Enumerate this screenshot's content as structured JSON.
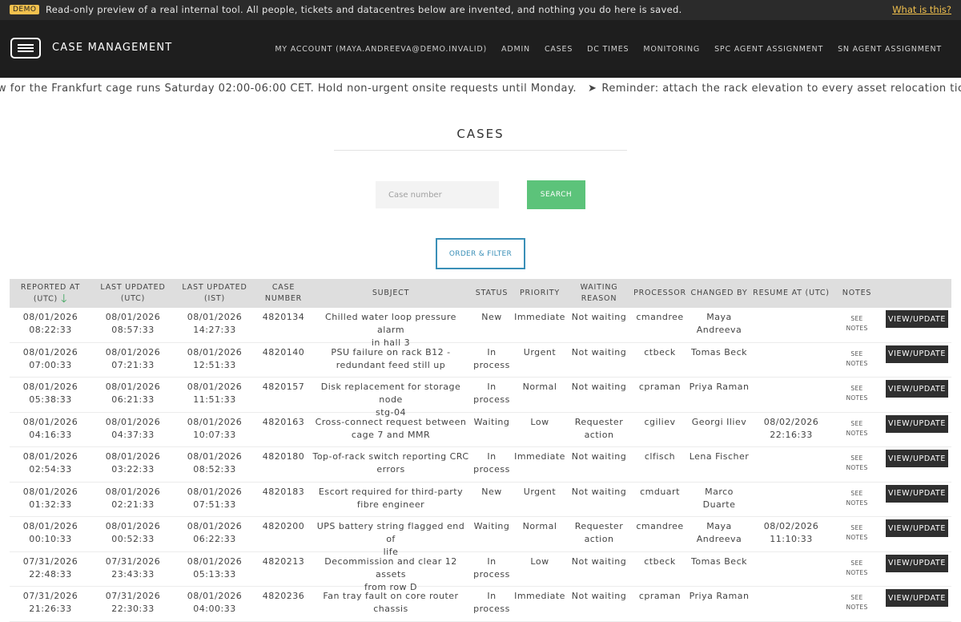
{
  "demo_bar": {
    "badge": "DEMO",
    "text": "Read-only preview of a real internal tool. All people, tickets and datacentres below are invented, and nothing you do here is saved.",
    "link": "What is this?"
  },
  "header": {
    "title": "CASE MANAGEMENT",
    "logo_icon": "menu-card-icon",
    "menu": [
      "MY ACCOUNT (MAYA.ANDREEVA@DEMO.INVALID)",
      "ADMIN",
      "CASES",
      "DC TIMES",
      "MONITORING",
      "SPC AGENT ASSIGNMENT",
      "SN AGENT ASSIGNMENT"
    ]
  },
  "ticker": {
    "text1": "w for the Frankfurt cage runs Saturday 02:00-06:00 CET. Hold non-urgent onsite requests until Monday.",
    "separator": "➤",
    "text2": "Reminder: attach the rack elevation to every asset relocation ticket b"
  },
  "page": {
    "title": "CASES",
    "search_placeholder": "Case number",
    "search_button": "SEARCH",
    "filter_button": "ORDER & FILTER"
  },
  "table": {
    "columns": {
      "reported_at": [
        "REPORTED AT",
        "(UTC)"
      ],
      "last_updated_utc": [
        "LAST UPDATED",
        "(UTC)"
      ],
      "last_updated_ist": [
        "LAST UPDATED",
        "(IST)"
      ],
      "case_number": [
        "CASE",
        "NUMBER"
      ],
      "subject": [
        "SUBJECT"
      ],
      "status": [
        "STATUS"
      ],
      "priority": [
        "PRIORITY"
      ],
      "waiting_reason": [
        "WAITING",
        "REASON"
      ],
      "processor": [
        "PROCESSOR"
      ],
      "changed_by": [
        "CHANGED BY"
      ],
      "resume_at": [
        "RESUME AT (UTC)"
      ],
      "notes": [
        "NOTES"
      ]
    },
    "sort_icon": "arrow-down-icon",
    "see_notes": "SEE\nNOTES",
    "view_update": "VIEW/UPDATE",
    "rows": [
      {
        "reported": "08/01/2026\n08:22:33",
        "upd_utc": "08/01/2026\n08:57:33",
        "upd_ist": "08/01/2026\n14:27:33",
        "case": "4820134",
        "subject": "Chilled water loop pressure alarm\nin hall 3",
        "status": "New",
        "priority": "Immediate",
        "waiting": "Not waiting",
        "processor": "cmandree",
        "changed_by": "Maya\nAndreeva",
        "resume": ""
      },
      {
        "reported": "08/01/2026\n07:00:33",
        "upd_utc": "08/01/2026\n07:21:33",
        "upd_ist": "08/01/2026\n12:51:33",
        "case": "4820140",
        "subject": "PSU failure on rack B12 -\nredundant feed still up",
        "status": "In\nprocess",
        "priority": "Urgent",
        "waiting": "Not waiting",
        "processor": "ctbeck",
        "changed_by": "Tomas Beck",
        "resume": ""
      },
      {
        "reported": "08/01/2026\n05:38:33",
        "upd_utc": "08/01/2026\n06:21:33",
        "upd_ist": "08/01/2026\n11:51:33",
        "case": "4820157",
        "subject": "Disk replacement for storage node\nstg-04",
        "status": "In\nprocess",
        "priority": "Normal",
        "waiting": "Not waiting",
        "processor": "cpraman",
        "changed_by": "Priya Raman",
        "resume": ""
      },
      {
        "reported": "08/01/2026\n04:16:33",
        "upd_utc": "08/01/2026\n04:37:33",
        "upd_ist": "08/01/2026\n10:07:33",
        "case": "4820163",
        "subject": "Cross-connect request between\ncage 7 and MMR",
        "status": "Waiting",
        "priority": "Low",
        "waiting": "Requester\naction",
        "processor": "cgiliev",
        "changed_by": "Georgi Iliev",
        "resume": "08/02/2026\n22:16:33"
      },
      {
        "reported": "08/01/2026\n02:54:33",
        "upd_utc": "08/01/2026\n03:22:33",
        "upd_ist": "08/01/2026\n08:52:33",
        "case": "4820180",
        "subject": "Top-of-rack switch reporting CRC\nerrors",
        "status": "In\nprocess",
        "priority": "Immediate",
        "waiting": "Not waiting",
        "processor": "clfisch",
        "changed_by": "Lena Fischer",
        "resume": ""
      },
      {
        "reported": "08/01/2026\n01:32:33",
        "upd_utc": "08/01/2026\n02:21:33",
        "upd_ist": "08/01/2026\n07:51:33",
        "case": "4820183",
        "subject": "Escort required for third-party\nfibre engineer",
        "status": "New",
        "priority": "Urgent",
        "waiting": "Not waiting",
        "processor": "cmduart",
        "changed_by": "Marco\nDuarte",
        "resume": ""
      },
      {
        "reported": "08/01/2026\n00:10:33",
        "upd_utc": "08/01/2026\n00:52:33",
        "upd_ist": "08/01/2026\n06:22:33",
        "case": "4820200",
        "subject": "UPS battery string flagged end of\nlife",
        "status": "Waiting",
        "priority": "Normal",
        "waiting": "Requester\naction",
        "processor": "cmandree",
        "changed_by": "Maya\nAndreeva",
        "resume": "08/02/2026\n11:10:33"
      },
      {
        "reported": "07/31/2026\n22:48:33",
        "upd_utc": "07/31/2026\n23:43:33",
        "upd_ist": "08/01/2026\n05:13:33",
        "case": "4820213",
        "subject": "Decommission and clear 12 assets\nfrom row D",
        "status": "In\nprocess",
        "priority": "Low",
        "waiting": "Not waiting",
        "processor": "ctbeck",
        "changed_by": "Tomas Beck",
        "resume": ""
      },
      {
        "reported": "07/31/2026\n21:26:33",
        "upd_utc": "07/31/2026\n22:30:33",
        "upd_ist": "08/01/2026\n04:00:33",
        "case": "4820236",
        "subject": "Fan tray fault on core router\nchassis",
        "status": "In\nprocess",
        "priority": "Immediate",
        "waiting": "Not waiting",
        "processor": "cpraman",
        "changed_by": "Priya Raman",
        "resume": ""
      }
    ]
  }
}
